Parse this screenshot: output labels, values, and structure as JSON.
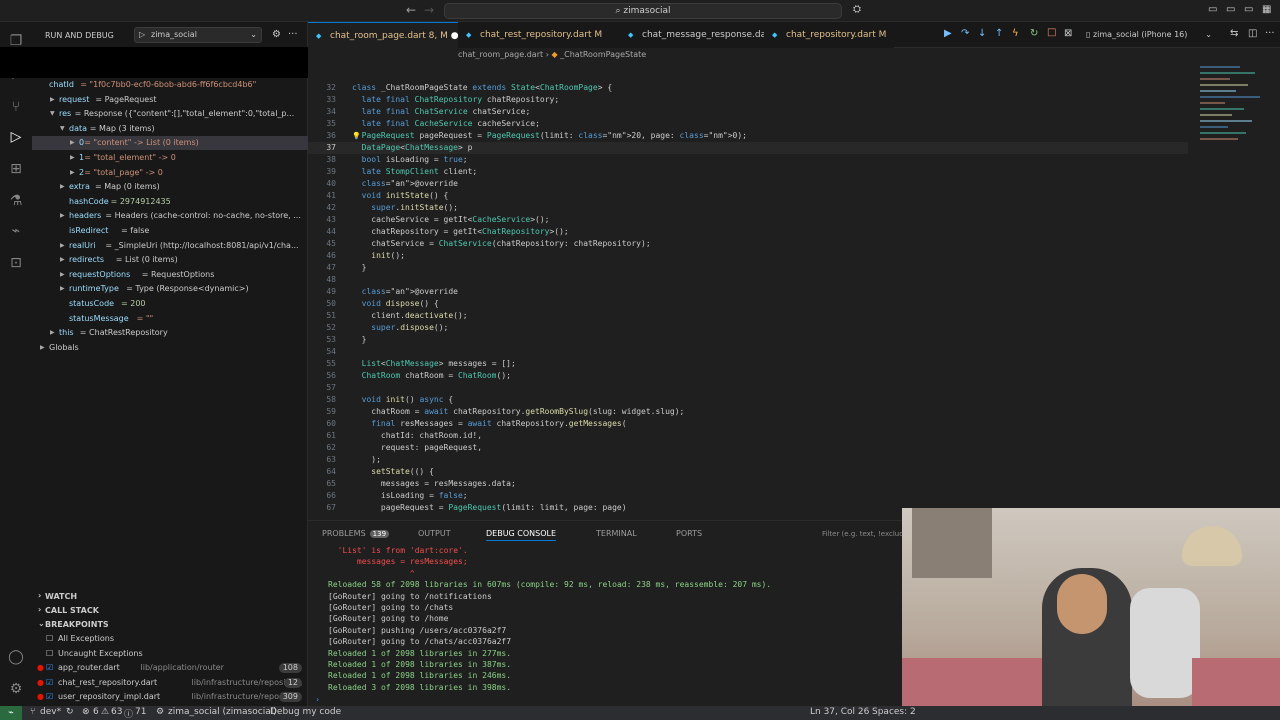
{
  "title_bar": {
    "search": "zimasocial"
  },
  "debug": {
    "panel_title": "RUN AND DEBUG",
    "config": "zima_social",
    "device": "zima_social (iPhone 16)"
  },
  "variables": [
    {
      "text": "chatId = \"1f0c7bb0-ecf0-6bob-abd6-ff6f6cbcd4b6\"",
      "indent": 0,
      "key": "chatId",
      "val": "\"1f0c7bb0-ecf0-6bob-abd6-ff6f6cbcd4b6\""
    },
    {
      "text": "request = PageRequest",
      "indent": 1,
      "key": "request",
      "val": "PageRequest",
      "arrow": "▶"
    },
    {
      "text": "res = Response ({\"content\":[],\"total_element\":0,\"total_p...",
      "indent": 1,
      "key": "res",
      "val": "Response ({\"content\":[],\"total_element\":0,\"total_p...",
      "arrow": "▼"
    },
    {
      "text": "data = Map (3 items)",
      "indent": 2,
      "key": "data",
      "val": "Map (3 items)",
      "arrow": "▼"
    },
    {
      "text": "0 = \"content\" -> List (0 items)",
      "indent": 3,
      "key": "0",
      "val": "\"content\" -> List (0 items)",
      "arrow": "▶",
      "selected": true
    },
    {
      "text": "1 = \"total_element\" -> 0",
      "indent": 3,
      "key": "1",
      "val": "\"total_element\" -> 0",
      "arrow": "▶"
    },
    {
      "text": "2 = \"total_page\" -> 0",
      "indent": 3,
      "key": "2",
      "val": "\"total_page\" -> 0",
      "arrow": "▶"
    },
    {
      "text": "extra = Map (0 items)",
      "indent": 2,
      "key": "extra",
      "val": "Map (0 items)",
      "arrow": "▶"
    },
    {
      "text": "hashCode = 2974912435",
      "indent": 2,
      "key": "hashCode",
      "val": "2974912435"
    },
    {
      "text": "headers = Headers (cache-control: no-cache, no-store,...",
      "indent": 2,
      "key": "headers",
      "val": "Headers (cache-control: no-cache, no-store, ...",
      "arrow": "▶"
    },
    {
      "text": "isRedirect = false",
      "indent": 2,
      "key": "isRedirect",
      "val": "false"
    },
    {
      "text": "realUri = _SimpleUri (http://localhost:8081/api/v1/cha...",
      "indent": 2,
      "key": "realUri",
      "val": "_SimpleUri (http://localhost:8081/api/v1/cha...",
      "arrow": "▶"
    },
    {
      "text": "redirects = List (0 items)",
      "indent": 2,
      "key": "redirects",
      "val": "List (0 items)",
      "arrow": "▶"
    },
    {
      "text": "requestOptions = RequestOptions",
      "indent": 2,
      "key": "requestOptions",
      "val": "RequestOptions",
      "arrow": "▶"
    },
    {
      "text": "runtimeType = Type (Response<dynamic>)",
      "indent": 2,
      "key": "runtimeType",
      "val": "Type (Response<dynamic>)",
      "arrow": "▶"
    },
    {
      "text": "statusCode = 200",
      "indent": 2,
      "key": "statusCode",
      "val": "200"
    },
    {
      "text": "statusMessage = \"\"",
      "indent": 2,
      "key": "statusMessage",
      "val": "\"\""
    },
    {
      "text": "this = ChatRestRepository",
      "indent": 1,
      "key": "this",
      "val": "ChatRestRepository",
      "arrow": "▶"
    },
    {
      "text": "Globals",
      "indent": 0,
      "key": "Globals",
      "val": "",
      "arrow": "▶"
    }
  ],
  "sections": {
    "watch": "WATCH",
    "call_stack": "CALL STACK",
    "breakpoints": "BREAKPOINTS"
  },
  "breakpoints": [
    {
      "label": "All Exceptions",
      "path": "",
      "count": "",
      "type": "checkbox"
    },
    {
      "label": "Uncaught Exceptions",
      "path": "",
      "count": "",
      "type": "checkbox"
    },
    {
      "label": "app_router.dart",
      "path": "lib/application/router",
      "count": "108",
      "type": "dot"
    },
    {
      "label": "chat_rest_repository.dart",
      "path": "lib/infrastructure/repository/...",
      "count": "12",
      "type": "dot"
    },
    {
      "label": "user_repository_impl.dart",
      "path": "lib/infrastructure/repositor...",
      "count": "309",
      "type": "dot"
    }
  ],
  "tabs": [
    {
      "name": "chat_room_page.dart",
      "badge": "8, M",
      "active": true,
      "dot": true
    },
    {
      "name": "chat_rest_repository.dart",
      "badge": "M",
      "active": false
    },
    {
      "name": "chat_message_response.dart",
      "badge": "",
      "active": false
    },
    {
      "name": "chat_repository.dart",
      "badge": "M",
      "active": false
    }
  ],
  "breadcrumb": [
    "chat_room_page.dart",
    "_ChatRoomPageState"
  ],
  "code": [
    {
      "n": "32",
      "t": "class _ChatRoomPageState extends State<ChatRoomPage> {"
    },
    {
      "n": "33",
      "t": "  late final ChatRepository chatRepository;"
    },
    {
      "n": "34",
      "t": "  late final ChatService chatService;"
    },
    {
      "n": "35",
      "t": "  late final CacheService cacheService;"
    },
    {
      "n": "36",
      "t": "  PageRequest pageRequest = PageRequest(limit: 20, page: 0);"
    },
    {
      "n": "37",
      "t": "  DataPage<ChatMessage> p"
    },
    {
      "n": "38",
      "t": "  bool isLoading = true;"
    },
    {
      "n": "39",
      "t": "  late StompClient client;"
    },
    {
      "n": "40",
      "t": "  @override"
    },
    {
      "n": "41",
      "t": "  void initState() {"
    },
    {
      "n": "42",
      "t": "    super.initState();"
    },
    {
      "n": "43",
      "t": "    cacheService = getIt<CacheService>();"
    },
    {
      "n": "44",
      "t": "    chatRepository = getIt<ChatRepository>();"
    },
    {
      "n": "45",
      "t": "    chatService = ChatService(chatRepository: chatRepository);"
    },
    {
      "n": "46",
      "t": "    init();"
    },
    {
      "n": "47",
      "t": "  }"
    },
    {
      "n": "48",
      "t": ""
    },
    {
      "n": "49",
      "t": "  @override"
    },
    {
      "n": "50",
      "t": "  void dispose() {"
    },
    {
      "n": "51",
      "t": "    client.deactivate();"
    },
    {
      "n": "52",
      "t": "    super.dispose();"
    },
    {
      "n": "53",
      "t": "  }"
    },
    {
      "n": "54",
      "t": ""
    },
    {
      "n": "55",
      "t": "  List<ChatMessage> messages = [];"
    },
    {
      "n": "56",
      "t": "  ChatRoom chatRoom = ChatRoom();"
    },
    {
      "n": "57",
      "t": ""
    },
    {
      "n": "58",
      "t": "  void init() async {"
    },
    {
      "n": "59",
      "t": "    chatRoom = await chatRepository.getRoomBySlug(slug: widget.slug);"
    },
    {
      "n": "60",
      "t": "    final resMessages = await chatRepository.getMessages("
    },
    {
      "n": "61",
      "t": "      chatId: chatRoom.id!,"
    },
    {
      "n": "62",
      "t": "      request: pageRequest,"
    },
    {
      "n": "63",
      "t": "    );"
    },
    {
      "n": "64",
      "t": "    setState(() {"
    },
    {
      "n": "65",
      "t": "      messages = resMessages.data;"
    },
    {
      "n": "66",
      "t": "      isLoading = false;"
    },
    {
      "n": "67",
      "t": "      pageRequest = PageRequest(limit: limit, page: page)"
    }
  ],
  "panel_tabs": [
    {
      "label": "PROBLEMS",
      "badge": "139"
    },
    {
      "label": "OUTPUT",
      "badge": ""
    },
    {
      "label": "DEBUG CONSOLE",
      "badge": "",
      "active": true
    },
    {
      "label": "TERMINAL",
      "badge": ""
    },
    {
      "label": "PORTS",
      "badge": ""
    }
  ],
  "filter_placeholder": "Filter (e.g. text, !exclude)",
  "console": [
    {
      "t": "  'List' is from 'dart:core'.",
      "c": "err"
    },
    {
      "t": "      messages = resMessages;",
      "c": "err"
    },
    {
      "t": "                 ^",
      "c": "err"
    },
    {
      "t": "Reloaded 58 of 2098 libraries in 607ms (compile: 92 ms, reload: 238 ms, reassemble: 207 ms).",
      "c": "info"
    },
    {
      "t": "[GoRouter] going to /notifications",
      "c": "log"
    },
    {
      "t": "[GoRouter] going to /chats",
      "c": "log"
    },
    {
      "t": "[GoRouter] going to /home",
      "c": "log"
    },
    {
      "t": "[GoRouter] pushing /users/acc0376a2f7",
      "c": "log"
    },
    {
      "t": "[GoRouter] going to /chats/acc0376a2f7",
      "c": "log"
    },
    {
      "t": "Reloaded 1 of 2098 libraries in 277ms.",
      "c": "info"
    },
    {
      "t": "Reloaded 1 of 2098 libraries in 387ms.",
      "c": "info"
    },
    {
      "t": "Reloaded 1 of 2098 libraries in 246ms.",
      "c": "info"
    },
    {
      "t": "Reloaded 3 of 2098 libraries in 398ms.",
      "c": "info"
    }
  ],
  "status": {
    "branch": "dev*",
    "errors": "6",
    "warnings": "63",
    "infos": "71",
    "project": "zima_social (zimasocial)",
    "mode": "Debug my code",
    "cursor": "Ln 37, Col 26",
    "spaces": "Spaces: 2"
  }
}
